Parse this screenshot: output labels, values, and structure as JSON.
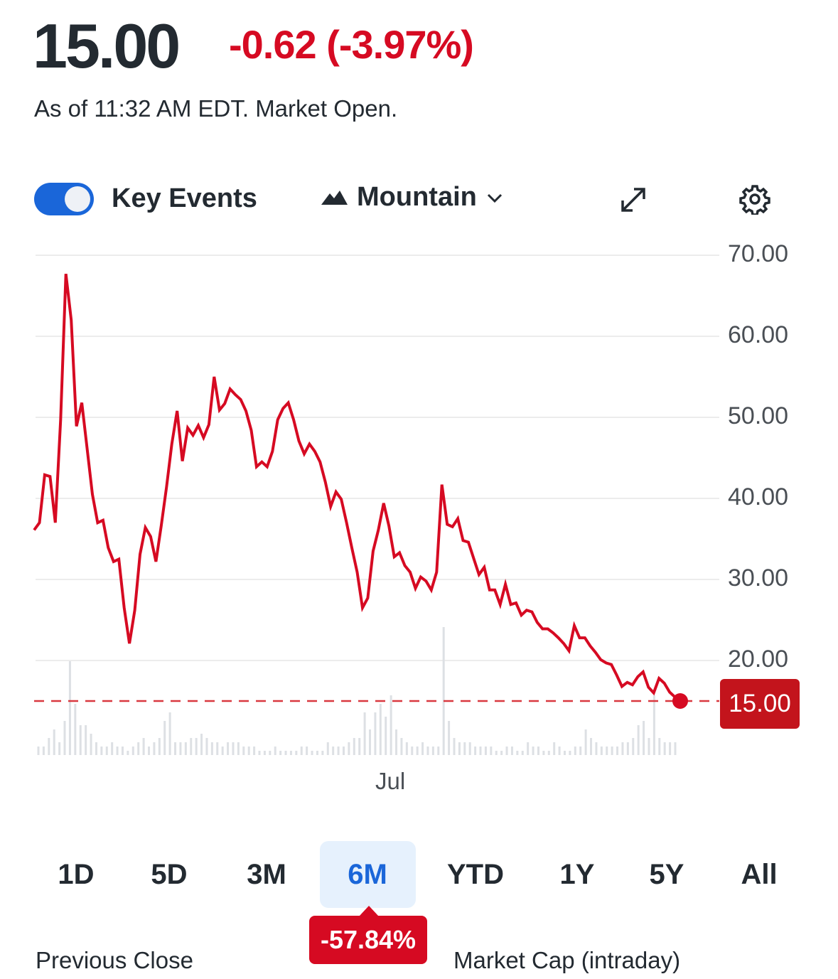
{
  "quote": {
    "price": "15.00",
    "change": "-0.62 (-3.97%)",
    "as_of": "As of 11:32 AM EDT. Market Open."
  },
  "toolbar": {
    "key_events_label": "Key Events",
    "key_events_on": true,
    "chart_type_label": "Mountain",
    "icons": [
      "mountain-icon",
      "chevron-down-icon",
      "expand-icon",
      "gear-icon"
    ]
  },
  "colors": {
    "line": "#d60a22",
    "accent": "#1a66d9",
    "price_tag": "#c3141c",
    "volume": "#dde0e4"
  },
  "chart_data": {
    "type": "area",
    "yticks": [
      "70.00",
      "60.00",
      "50.00",
      "40.00",
      "30.00",
      "20.00"
    ],
    "ylim": [
      14,
      70
    ],
    "xticks": [
      "Jul"
    ],
    "grid": true,
    "current_price_label": "15.00",
    "current_price": 15.0,
    "values": [
      36.1,
      37.0,
      42.9,
      42.7,
      37.0,
      49.7,
      67.7,
      62.0,
      48.9,
      51.8,
      46.2,
      40.5,
      37.0,
      37.3,
      33.9,
      32.2,
      32.5,
      26.5,
      22.1,
      26.2,
      33.1,
      36.4,
      35.3,
      32.2,
      36.6,
      41.4,
      46.7,
      50.8,
      44.6,
      48.7,
      47.8,
      49.0,
      47.5,
      49.1,
      55.0,
      50.9,
      51.7,
      53.5,
      52.8,
      52.2,
      50.8,
      48.4,
      43.9,
      44.5,
      43.9,
      45.8,
      49.7,
      51.1,
      51.8,
      49.7,
      47.1,
      45.5,
      46.7,
      45.8,
      44.5,
      42.0,
      39.0,
      40.8,
      39.9,
      37.0,
      33.9,
      30.9,
      26.5,
      27.7,
      33.5,
      36.1,
      39.4,
      36.6,
      32.8,
      33.3,
      31.7,
      30.9,
      28.9,
      30.3,
      29.8,
      28.7,
      30.9,
      41.7,
      36.8,
      36.5,
      37.5,
      34.8,
      34.6,
      32.6,
      30.6,
      31.5,
      28.7,
      28.7,
      26.9,
      29.4,
      26.9,
      27.1,
      25.6,
      26.2,
      26.0,
      24.7,
      23.9,
      23.9,
      23.4,
      22.8,
      22.1,
      21.2,
      24.3,
      22.8,
      22.8,
      21.8,
      21.0,
      20.1,
      19.7,
      19.5,
      18.2,
      16.8,
      17.3,
      17.0,
      18.0,
      18.6,
      16.7,
      16.0,
      17.8,
      17.2,
      16.1,
      15.5,
      15.0
    ],
    "volume": [
      2,
      2,
      4,
      6,
      3,
      8,
      22,
      12,
      7,
      7,
      5,
      3,
      2,
      2,
      3,
      2,
      2,
      1,
      2,
      3,
      4,
      2,
      3,
      4,
      8,
      10,
      3,
      3,
      3,
      4,
      4,
      5,
      4,
      3,
      3,
      2,
      3,
      3,
      3,
      2,
      2,
      2,
      1,
      1,
      1,
      2,
      1,
      1,
      1,
      1,
      2,
      2,
      1,
      1,
      1,
      3,
      2,
      2,
      2,
      3,
      4,
      4,
      10,
      6,
      10,
      12,
      9,
      14,
      6,
      4,
      3,
      2,
      2,
      3,
      2,
      2,
      2,
      30,
      8,
      4,
      3,
      3,
      3,
      2,
      2,
      2,
      2,
      1,
      1,
      2,
      2,
      1,
      1,
      3,
      2,
      2,
      1,
      1,
      3,
      2,
      1,
      1,
      2,
      2,
      6,
      4,
      3,
      2,
      2,
      2,
      2,
      3,
      3,
      4,
      7,
      8,
      4,
      14,
      4,
      3,
      3,
      3
    ],
    "range_change": "-57.84%"
  },
  "ranges": [
    {
      "label": "1D"
    },
    {
      "label": "5D"
    },
    {
      "label": "3M"
    },
    {
      "label": "6M",
      "selected": true
    },
    {
      "label": "YTD"
    },
    {
      "label": "1Y"
    },
    {
      "label": "5Y"
    },
    {
      "label": "All"
    }
  ],
  "stats": {
    "previous_close_label": "Previous Close",
    "market_cap_label": "Market Cap (intraday)"
  }
}
